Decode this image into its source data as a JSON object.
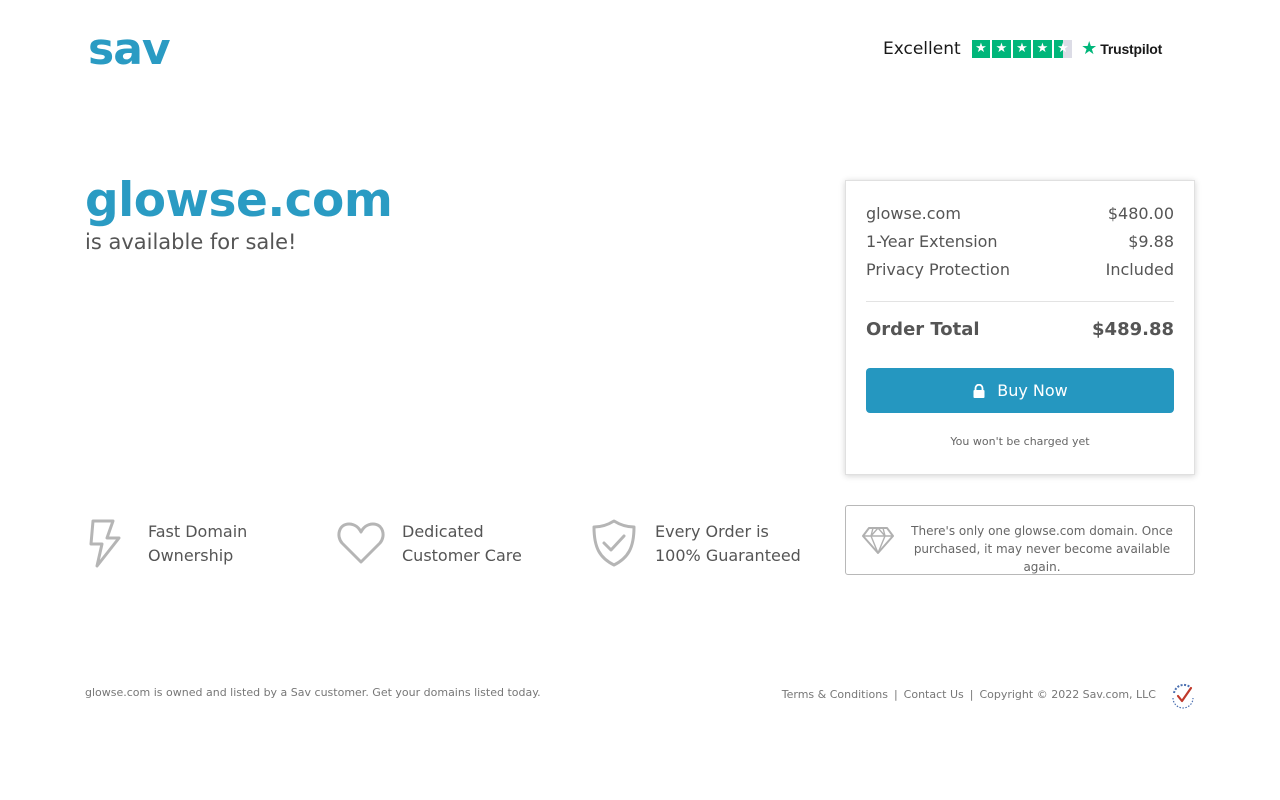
{
  "header": {
    "logo_text": "sav",
    "trustpilot": {
      "rating_text": "Excellent",
      "brand": "Trustpilot",
      "stars_filled": 4.5,
      "stars_total": 5
    }
  },
  "hero": {
    "domain": "glowse.com",
    "subtitle": "is available for sale!"
  },
  "order": {
    "rows": [
      {
        "label": "glowse.com",
        "value": "$480.00"
      },
      {
        "label": "1-Year Extension",
        "value": "$9.88"
      },
      {
        "label": "Privacy Protection",
        "value": "Included"
      }
    ],
    "total_label": "Order Total",
    "total_value": "$489.88",
    "buy_button_label": "Buy Now",
    "charge_note": "You won't be charged yet"
  },
  "features": [
    {
      "line1": "Fast Domain",
      "line2": "Ownership",
      "icon": "lightning-icon"
    },
    {
      "line1": "Dedicated",
      "line2": "Customer Care",
      "icon": "heart-icon"
    },
    {
      "line1": "Every Order is",
      "line2": "100% Guaranteed",
      "icon": "shield-check-icon"
    }
  ],
  "unique_notice": {
    "icon": "diamond-icon",
    "text": "There's only one glowse.com domain. Once purchased, it may never become available again."
  },
  "footer": {
    "left_text": "glowse.com is owned and listed by a Sav customer. Get your domains listed today.",
    "terms_label": "Terms & Conditions",
    "contact_label": "Contact Us",
    "copyright": "Copyright © 2022 Sav.com, LLC",
    "separator": "|"
  },
  "colors": {
    "brand": "#2a9bc3",
    "button": "#2597c0",
    "trustpilot_green": "#00b67a",
    "text": "#555555"
  }
}
